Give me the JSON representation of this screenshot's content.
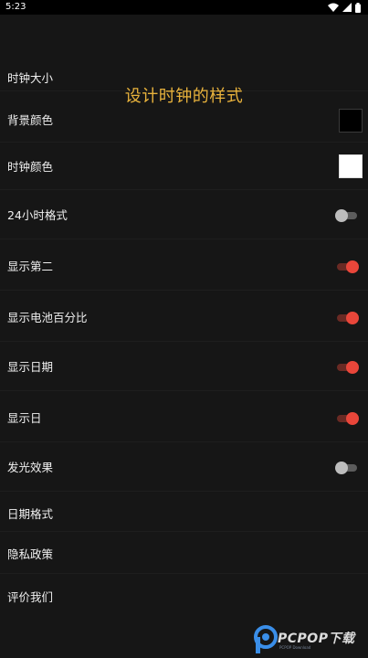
{
  "status_bar": {
    "time": "5:23",
    "icons": [
      "wifi-icon",
      "signal-icon",
      "battery-icon"
    ]
  },
  "title": "设计时钟的样式",
  "settings": {
    "clock_size": {
      "label": "时钟大小"
    },
    "background_color": {
      "label": "背景颜色",
      "swatch": "#000000"
    },
    "clock_color": {
      "label": "时钟颜色",
      "swatch": "#ffffff"
    },
    "format_24h": {
      "label": "24小时格式",
      "enabled": false
    },
    "show_seconds": {
      "label": "显示第二",
      "enabled": true
    },
    "show_battery": {
      "label": "显示电池百分比",
      "enabled": true
    },
    "show_date": {
      "label": "显示日期",
      "enabled": true
    },
    "show_day": {
      "label": "显示日",
      "enabled": true
    },
    "glow_effect": {
      "label": "发光效果",
      "enabled": false
    },
    "date_format": {
      "label": "日期格式"
    },
    "privacy_policy": {
      "label": "隐私政策"
    },
    "rate_us": {
      "label": "评价我们"
    }
  },
  "colors": {
    "title": "#e8b23c",
    "toggle_on": "#e9463a",
    "toggle_off": "#bdbdbd"
  },
  "watermark": {
    "text": "PCPOP下载",
    "sub": "PCPOP Download"
  }
}
